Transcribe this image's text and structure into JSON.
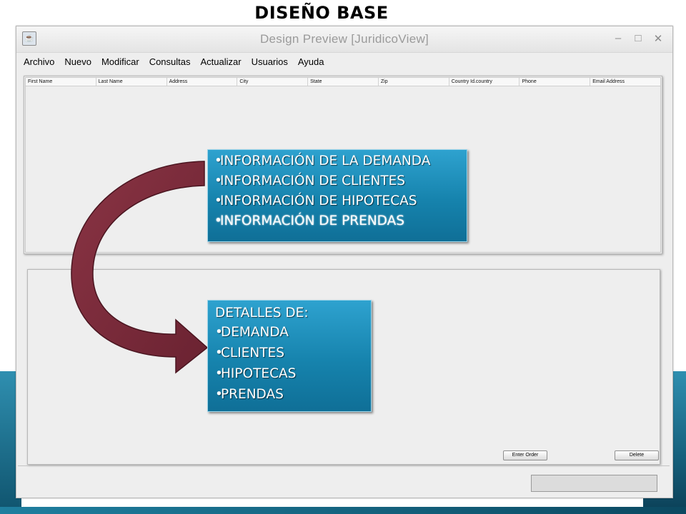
{
  "slide": {
    "title": "DISEÑO BASE"
  },
  "window": {
    "title": "Design Preview [JuridicoView]",
    "controls": [
      "–",
      "□",
      "✕"
    ]
  },
  "menu": [
    "Archivo",
    "Nuevo",
    "Modificar",
    "Consultas",
    "Actualizar",
    "Usuarios",
    "Ayuda"
  ],
  "table": {
    "columns": [
      "First Name",
      "Last Name",
      "Address",
      "City",
      "State",
      "Zip",
      "Country Id.country",
      "Phone",
      "Email Address"
    ]
  },
  "buttons": {
    "enter_order": "Enter Order",
    "delete": "Delete"
  },
  "callout_top": {
    "items": [
      "INFORMACIÓN DE LA DEMANDA",
      "INFORMACIÓN DE CLIENTES",
      "INFORMACIÓN DE HIPOTECAS",
      "INFORMACIÓN DE PRENDAS"
    ]
  },
  "callout_bottom": {
    "heading": "DETALLES DE:",
    "items": [
      "DEMANDA",
      "CLIENTES",
      "HIPOTECAS",
      "PRENDAS"
    ]
  },
  "colors": {
    "callout": "#1683ad",
    "arrow": "#7a2d3a",
    "swoosh": "#16607c"
  }
}
